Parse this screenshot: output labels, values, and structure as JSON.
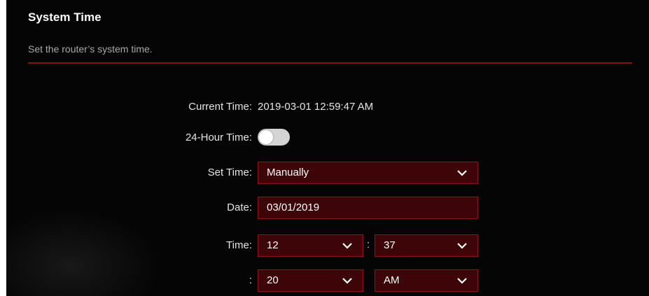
{
  "header": {
    "title": "System Time",
    "subtitle": "Set the router’s system time."
  },
  "form": {
    "current_time_label": "Current Time:",
    "current_time_value": "2019-03-01 12:59:47 AM",
    "hour24_label": "24-Hour Time:",
    "hour24_enabled": false,
    "set_time_label": "Set Time:",
    "set_time_value": "Manually",
    "date_label": "Date:",
    "date_value": "03/01/2019",
    "time_label": "Time:",
    "hour_value": "12",
    "minute_value": "37",
    "time_separator": ":",
    "seconds_separator": ":",
    "second_value": "20",
    "ampm_value": "AM"
  },
  "colors": {
    "panel_bg": "#050505",
    "accent_red": "#8e1419",
    "field_bg": "#3d0507"
  }
}
